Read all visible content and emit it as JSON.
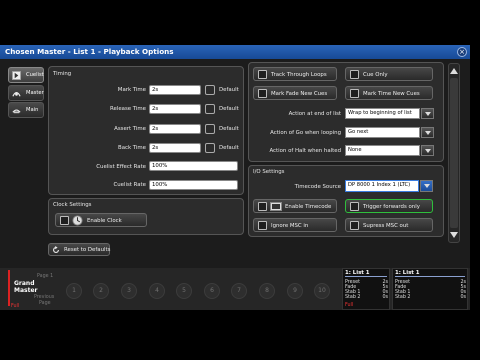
{
  "window": {
    "title": "Chosen Master - List 1 - Playback Options",
    "close_glyph": "×"
  },
  "sidebar": {
    "items": [
      {
        "label": "Cuelist",
        "icon": "cuelist-icon",
        "active": true
      },
      {
        "label": "Master",
        "icon": "master-icon",
        "active": false
      },
      {
        "label": "Main",
        "icon": "main-icon",
        "active": false
      }
    ]
  },
  "timing": {
    "title": "Timing",
    "rows": [
      {
        "label": "Mark Time",
        "value": "2s",
        "default_label": "Default"
      },
      {
        "label": "Release Time",
        "value": "2s",
        "default_label": "Default"
      },
      {
        "label": "Assert Time",
        "value": "2s",
        "default_label": "Default"
      },
      {
        "label": "Back Time",
        "value": "2s",
        "default_label": "Default"
      }
    ],
    "effect_rate_label": "Cuelist Effect Rate",
    "effect_rate_value": "100%",
    "cuelist_rate_label": "Cuelist Rate",
    "cuelist_rate_value": "100%"
  },
  "clock": {
    "title": "Clock Settings",
    "enable_label": "Enable Clock"
  },
  "reset_label": "Reset to Defaults",
  "options": {
    "toggles": [
      "Track Through Loops",
      "Cue Only",
      "Mark Fade New Cues",
      "Mark Time New Cues"
    ],
    "end_of_list_label": "Action at end of list",
    "end_of_list_value": "Wrap to beginning of list",
    "go_looping_label": "Action of Go when looping",
    "go_looping_value": "Go next",
    "halt_label": "Action of Halt when halted",
    "halt_value": "None"
  },
  "io": {
    "title": "I/O Settings",
    "timecode_source_label": "Timecode Source",
    "timecode_source_value": "DP 8000 1 Index 1 (LTC)",
    "enable_timecode": "Enable Timecode",
    "trigger_forwards": "Trigger forwards only",
    "ignore_msc": "Ignore MSC in",
    "supress_msc": "Supress MSC out"
  },
  "playback": {
    "grand_master_1": "Grand",
    "grand_master_2": "Master",
    "grand_master_value": "Full",
    "page_label": "Page 1",
    "previous_label": "Previous",
    "page_label2": "Page",
    "faders": [
      "1",
      "2",
      "3",
      "4",
      "5",
      "6",
      "7",
      "8",
      "9",
      "10"
    ],
    "cues": [
      {
        "header": "1: List 1",
        "rows": [
          [
            "Preset",
            "2s"
          ],
          [
            "Fade",
            "5s"
          ],
          [
            "Stab 1",
            "0s"
          ],
          [
            "Stab 2",
            "0s"
          ]
        ],
        "footer": "Full"
      },
      {
        "header": "1: List 1",
        "rows": [
          [
            "Preset",
            "2s"
          ],
          [
            "Fade",
            "5s"
          ],
          [
            "Stab 1",
            "0s"
          ],
          [
            "Stab 2",
            "0s"
          ]
        ],
        "footer": ""
      }
    ]
  },
  "colors": {
    "title_bar": "#1f56a8",
    "highlight": "#2fbf3c",
    "grand_master": "#d22222"
  }
}
